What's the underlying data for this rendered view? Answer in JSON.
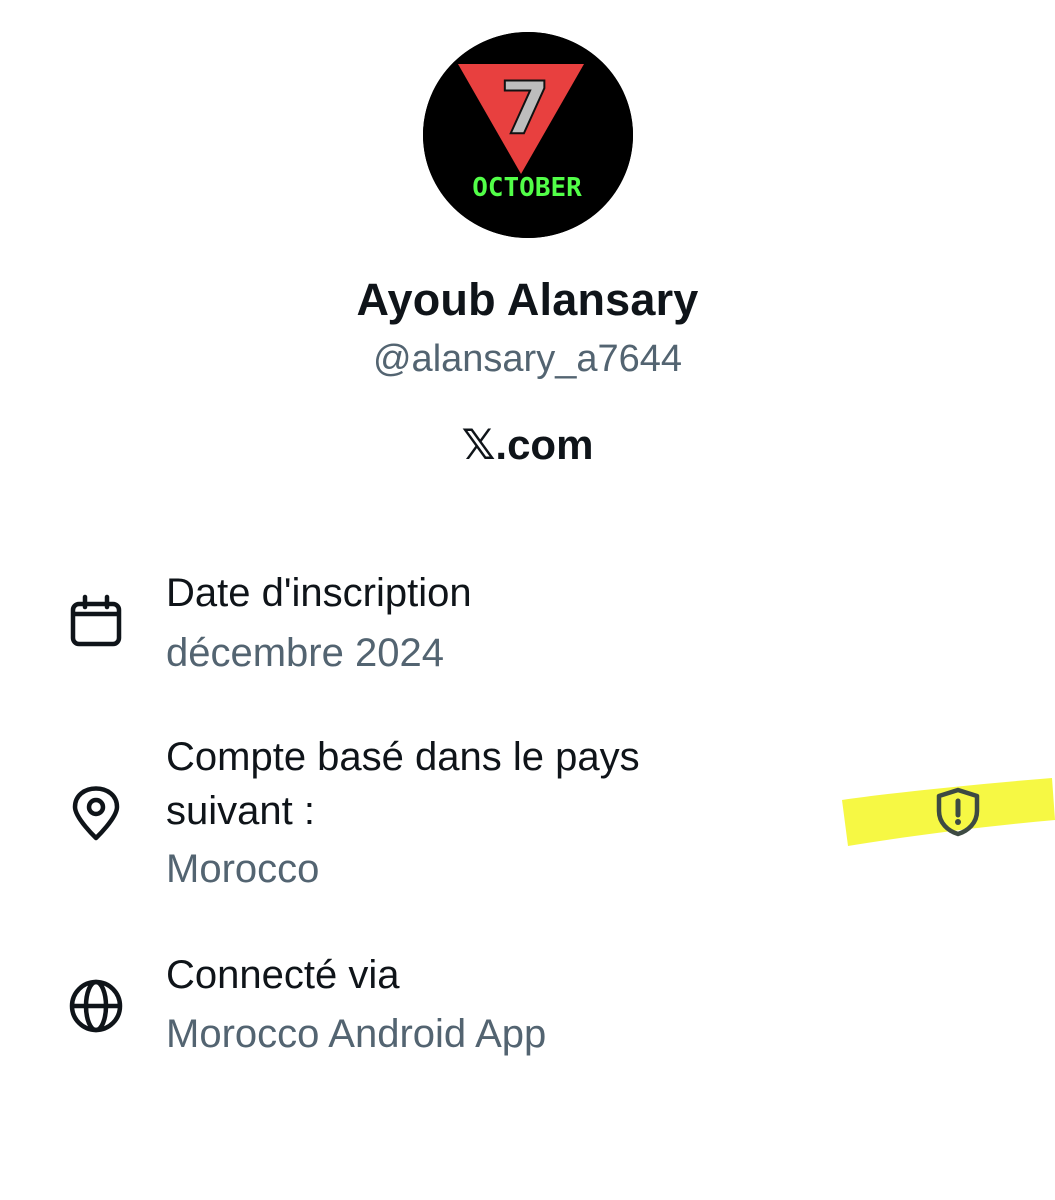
{
  "profile": {
    "avatar_icon": "triangle-7-october-logo",
    "avatar_text": {
      "digit": "7",
      "word": "OCTOBER"
    },
    "display_name": "Ayoub Alansary",
    "handle": "@alansary_a7644",
    "site": "𝕏.com"
  },
  "info": {
    "joined": {
      "icon": "calendar-icon",
      "title": "Date d'inscription",
      "value": "décembre 2024"
    },
    "based_in": {
      "icon": "location-pin-icon",
      "title": "Compte basé dans le pays suivant :",
      "value": "Morocco",
      "badge_icon": "shield-alert-icon"
    },
    "connected": {
      "icon": "globe-icon",
      "title": "Connecté via",
      "value": "Morocco Android App"
    }
  },
  "colors": {
    "text_primary": "#0f1419",
    "text_secondary": "#536471",
    "avatar_red": "#e8403f",
    "avatar_green": "#52ff48",
    "highlight_yellow": "#f6f83a"
  }
}
